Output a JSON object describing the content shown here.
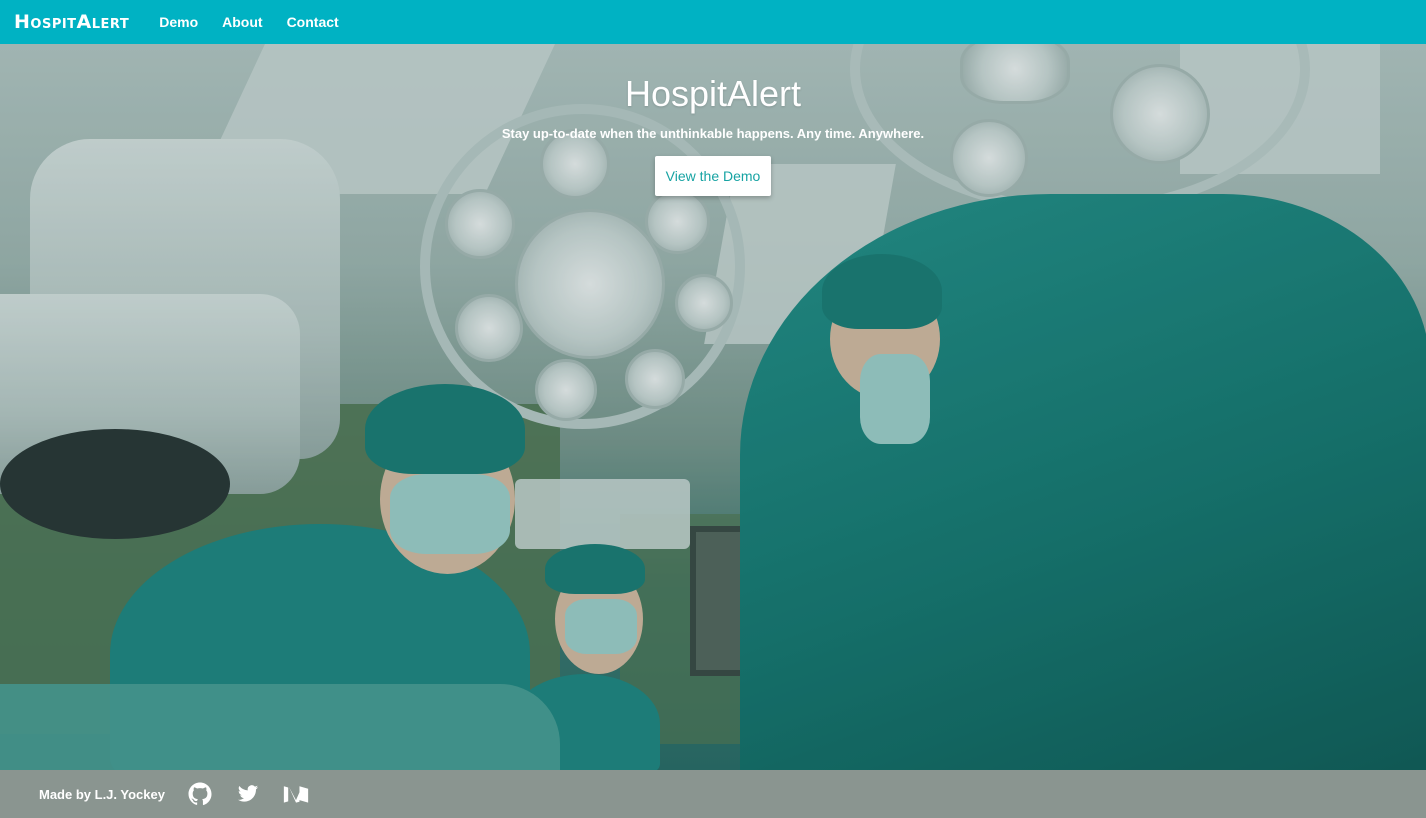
{
  "navbar": {
    "brand": "HospitAlert",
    "links": [
      "Demo",
      "About",
      "Contact"
    ]
  },
  "hero": {
    "title": "HospitAlert",
    "subtitle": "Stay up-to-date when the unthinkable happens. Any time. Anywhere.",
    "button_label": "View the Demo",
    "image_alt_icon": "operating-room-photo"
  },
  "footer": {
    "credit": "Made by L.J. Yockey",
    "icons": [
      "github-icon",
      "twitter-icon",
      "medium-icon"
    ]
  },
  "colors": {
    "navbar_bg": "#00b2c3",
    "footer_bg": "#8a9590",
    "button_text": "#17a3a3",
    "text": "#ffffff"
  }
}
